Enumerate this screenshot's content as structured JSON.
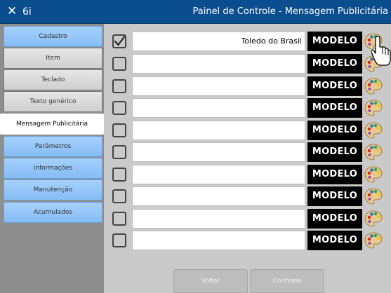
{
  "titlebar": {
    "close_glyph": "✕",
    "app_name": "6i",
    "title": "Painel de Controle - Mensagem Publicitária"
  },
  "sidebar": {
    "items": [
      {
        "label": "Cadastro",
        "style": "blue"
      },
      {
        "label": "Item",
        "style": "gray"
      },
      {
        "label": "Teclado",
        "style": "gray"
      },
      {
        "label": "Texto genérico",
        "style": "gray"
      },
      {
        "label": "Mensagem Publicitária",
        "style": "selected"
      },
      {
        "label": "Parâmetros",
        "style": "blue"
      },
      {
        "label": "Informações",
        "style": "blue"
      },
      {
        "label": "Manutenção",
        "style": "blue"
      },
      {
        "label": "Acumulados",
        "style": "blue"
      }
    ]
  },
  "rows": [
    {
      "checked": true,
      "text": "Toledo do Brasil",
      "button_label": "MODELO",
      "palette_icon": "palette-icon"
    },
    {
      "checked": false,
      "text": "",
      "button_label": "MODELO",
      "palette_icon": "palette-icon"
    },
    {
      "checked": false,
      "text": "",
      "button_label": "MODELO",
      "palette_icon": "palette-icon"
    },
    {
      "checked": false,
      "text": "",
      "button_label": "MODELO",
      "palette_icon": "palette-icon"
    },
    {
      "checked": false,
      "text": "",
      "button_label": "MODELO",
      "palette_icon": "palette-icon"
    },
    {
      "checked": false,
      "text": "",
      "button_label": "MODELO",
      "palette_icon": "palette-icon"
    },
    {
      "checked": false,
      "text": "",
      "button_label": "MODELO",
      "palette_icon": "palette-icon"
    },
    {
      "checked": false,
      "text": "",
      "button_label": "MODELO",
      "palette_icon": "palette-icon"
    },
    {
      "checked": false,
      "text": "",
      "button_label": "MODELO",
      "palette_icon": "palette-icon"
    },
    {
      "checked": false,
      "text": "",
      "button_label": "MODELO",
      "palette_icon": "palette-icon"
    }
  ],
  "footer": {
    "back_label": "Voltar",
    "confirm_label": "Confirma"
  },
  "colors": {
    "titlebar": "#0a4e8f",
    "nav_blue": "#85bdf6",
    "nav_gray": "#d6d6d6",
    "content_bg": "#cacaca",
    "modelo_bg": "#000000"
  }
}
